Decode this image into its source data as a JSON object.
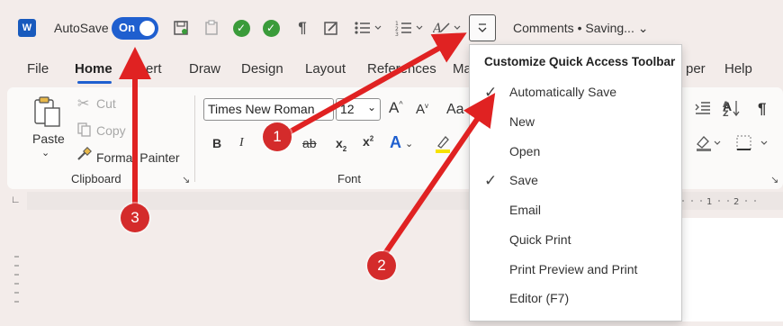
{
  "qat": {
    "app_icon_label": "W",
    "autosave_label": "AutoSave",
    "autosave_state": "On",
    "comments_status": "Comments • Saving... ⌄"
  },
  "tabs": [
    "File",
    "Home",
    "Insert",
    "Draw",
    "Design",
    "Layout",
    "References",
    "Ma",
    "per",
    "Help"
  ],
  "ribbon": {
    "paste_label": "Paste",
    "cut_label": "Cut",
    "copy_label": "Copy",
    "format_painter_label": "Format Painter",
    "clipboard_group": "Clipboard",
    "font_name": "Times New Roman",
    "font_size": "12",
    "font_group": "Font",
    "aa_label": "Aa"
  },
  "menu": {
    "title": "Customize Quick Access Toolbar",
    "items": [
      {
        "label": "Automatically Save",
        "checked": "✓"
      },
      {
        "label": "New",
        "checked": ""
      },
      {
        "label": "Open",
        "checked": ""
      },
      {
        "label": "Save",
        "checked": "✓"
      },
      {
        "label": "Email",
        "checked": ""
      },
      {
        "label": "Quick Print",
        "checked": ""
      },
      {
        "label": "Print Preview and Print",
        "checked": ""
      },
      {
        "label": "Editor (F7)",
        "checked": ""
      }
    ]
  },
  "annotations": [
    "1",
    "2",
    "3"
  ],
  "colors": {
    "accent": "#1f5fcf",
    "annotation": "#e02222"
  }
}
